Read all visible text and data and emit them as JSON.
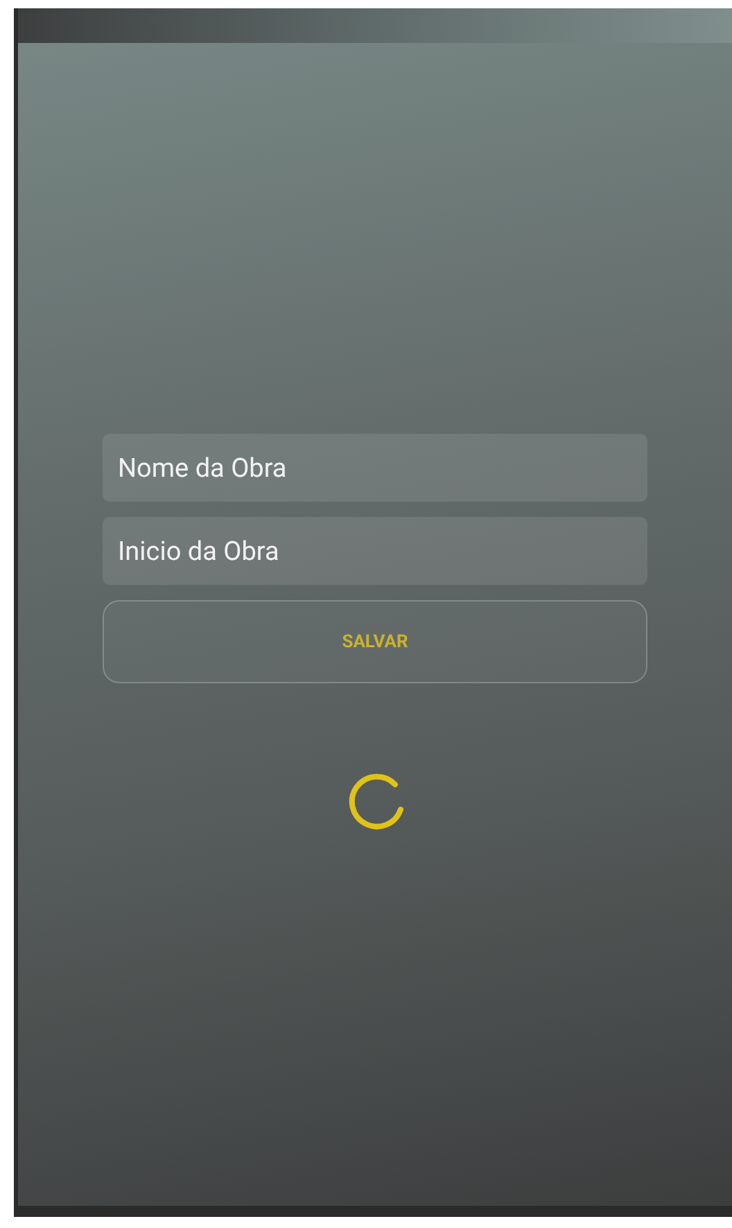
{
  "form": {
    "fields": [
      {
        "placeholder": "Nome da Obra"
      },
      {
        "placeholder": "Inicio da Obra"
      }
    ],
    "save_button": {
      "label": "SALVAR"
    }
  },
  "loading": true
}
